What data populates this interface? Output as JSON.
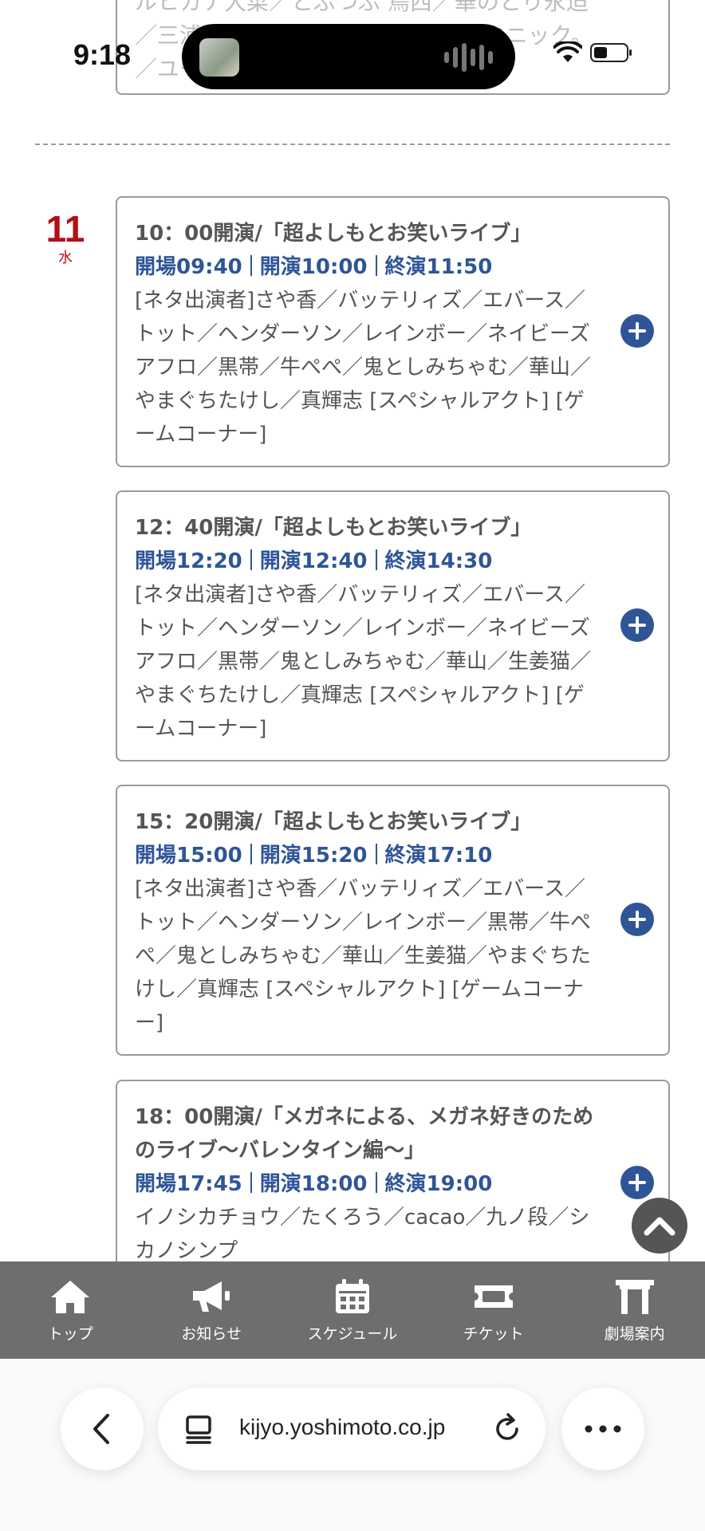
{
  "status_bar": {
    "time": "9:18"
  },
  "top_card": {
    "text": "ルヒカナ大菜／とぶつぶ 鳥西／華のとり永迫／三浦関 オくらい／マーメイド テクニック。／ユームス・ーース 福浜"
  },
  "date": {
    "day": "11",
    "weekday": "水"
  },
  "performances": [
    {
      "title": "10：00開演/「超よしもとお笑いライブ」",
      "open": "開場09:40",
      "start": "開演10:00",
      "end": "終演11:50",
      "cast": "[ネタ出演者]さや香／バッテリィズ／エバース／トット／ヘンダーソン／レインボー／ネイビーズアフロ／黒帯／牛ぺぺ／鬼としみちゃむ／華山／やまぐちたけし／真輝志 [スペシャルアクト] [ゲームコーナー]"
    },
    {
      "title": "12：40開演/「超よしもとお笑いライブ」",
      "open": "開場12:20",
      "start": "開演12:40",
      "end": "終演14:30",
      "cast": "[ネタ出演者]さや香／バッテリィズ／エバース／トット／ヘンダーソン／レインボー／ネイビーズアフロ／黒帯／鬼としみちゃむ／華山／生姜猫／やまぐちたけし／真輝志 [スペシャルアクト] [ゲームコーナー]"
    },
    {
      "title": "15：20開演/「超よしもとお笑いライブ」",
      "open": "開場15:00",
      "start": "開演15:20",
      "end": "終演17:10",
      "cast": "[ネタ出演者]さや香／バッテリィズ／エバース／トット／ヘンダーソン／レインボー／黒帯／牛ぺぺ／鬼としみちゃむ／華山／生姜猫／やまぐちたけし／真輝志 [スペシャルアクト] [ゲームコーナー]"
    },
    {
      "title": "18：00開演/「メガネによる、メガネ好きのためのライブ～バレンタイン編～」",
      "open": "開場17:45",
      "start": "開演18:00",
      "end": "終演19:00",
      "cast": "イノシカチョウ／たくろう／cacao／九ノ段／シカノシンプ"
    }
  ],
  "bottom_nav": [
    {
      "label": "トップ",
      "icon": "home-icon"
    },
    {
      "label": "お知らせ",
      "icon": "megaphone-icon"
    },
    {
      "label": "スケジュール",
      "icon": "calendar-icon"
    },
    {
      "label": "チケット",
      "icon": "ticket-icon"
    },
    {
      "label": "劇場案内",
      "icon": "theater-icon"
    }
  ],
  "browser": {
    "url": "kijyo.yoshimoto.co.jp"
  },
  "colors": {
    "accent": "#2f5597",
    "date_red": "#b30f15",
    "nav_bg": "#6e6e6e"
  }
}
